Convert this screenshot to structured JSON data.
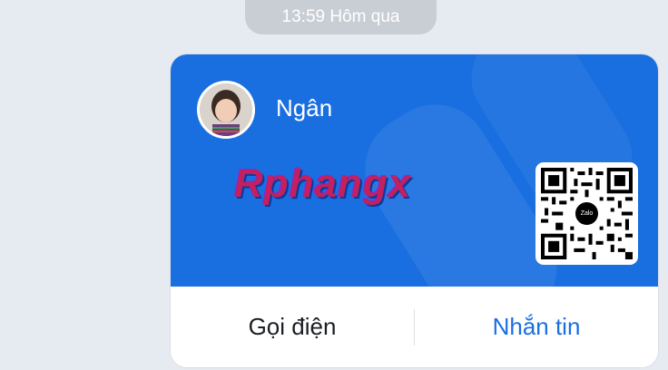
{
  "timestamp": "13:59 Hôm qua",
  "card": {
    "name": "Ngân",
    "watermark": "Rphangx",
    "qr_logo": "Zalo",
    "accent_color": "#1a6fe0",
    "call_label": "Gọi điện",
    "message_label": "Nhắn tin"
  }
}
